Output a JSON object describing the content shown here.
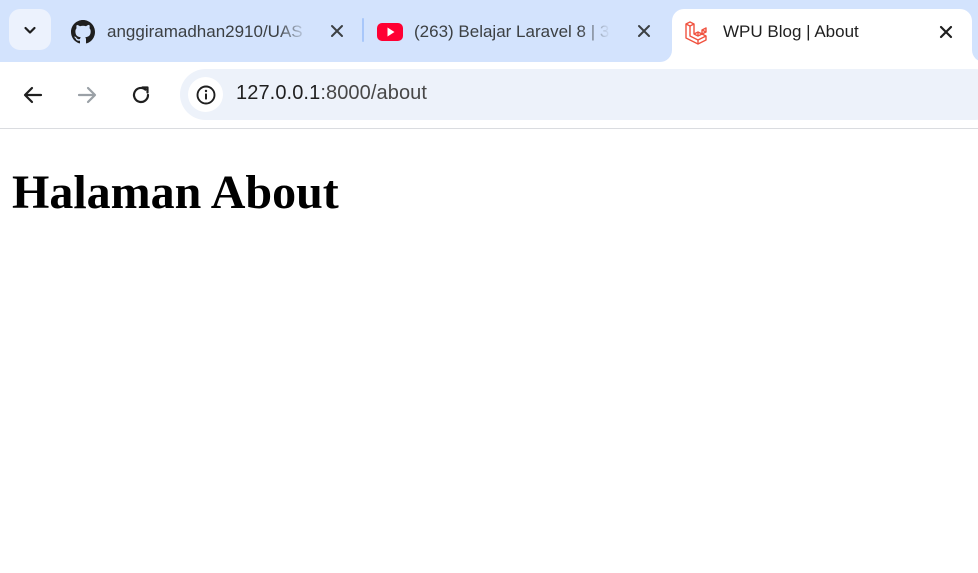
{
  "tabs": [
    {
      "title": "anggiramadhan2910/UAS",
      "favicon": "github-icon",
      "active": false
    },
    {
      "title": "(263) Belajar Laravel 8 | 3",
      "favicon": "youtube-icon",
      "active": false
    },
    {
      "title": "WPU Blog | About",
      "favicon": "laravel-icon",
      "active": true
    }
  ],
  "toolbar": {
    "url_host": "127.0.0.1",
    "url_path": ":8000/about"
  },
  "page": {
    "heading": "Halaman About"
  },
  "colors": {
    "tabstrip_bg": "#d3e3fd",
    "omnibox_bg": "#edf2fa",
    "youtube_red": "#ff0033",
    "laravel_red": "#f05340"
  }
}
